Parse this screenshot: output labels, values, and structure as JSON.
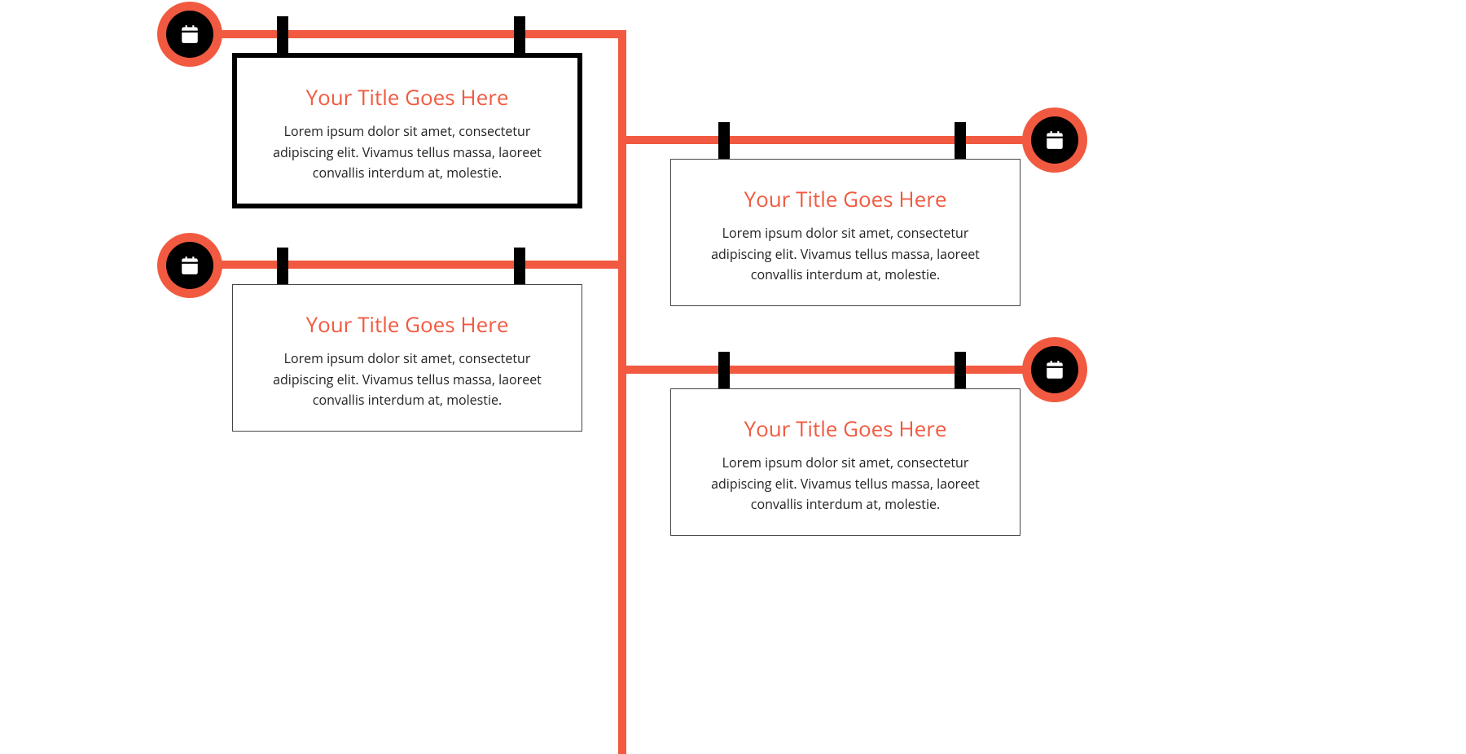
{
  "accent": "#f15a40",
  "nodes": [
    {
      "title": "Your Title Goes Here",
      "body": "Lorem ipsum dolor sit amet, consectetur adipiscing elit. Vivamus tellus massa, laoreet convallis interdum at, molestie."
    },
    {
      "title": "Your Title Goes Here",
      "body": "Lorem ipsum dolor sit amet, consectetur adipiscing elit. Vivamus tellus massa, laoreet convallis interdum at, molestie."
    },
    {
      "title": "Your Title Goes Here",
      "body": "Lorem ipsum dolor sit amet, consectetur adipiscing elit. Vivamus tellus massa, laoreet convallis interdum at, molestie."
    },
    {
      "title": "Your Title Goes Here",
      "body": "Lorem ipsum dolor sit amet, consectetur adipiscing elit. Vivamus tellus massa, laoreet convallis interdum at, molestie."
    }
  ]
}
